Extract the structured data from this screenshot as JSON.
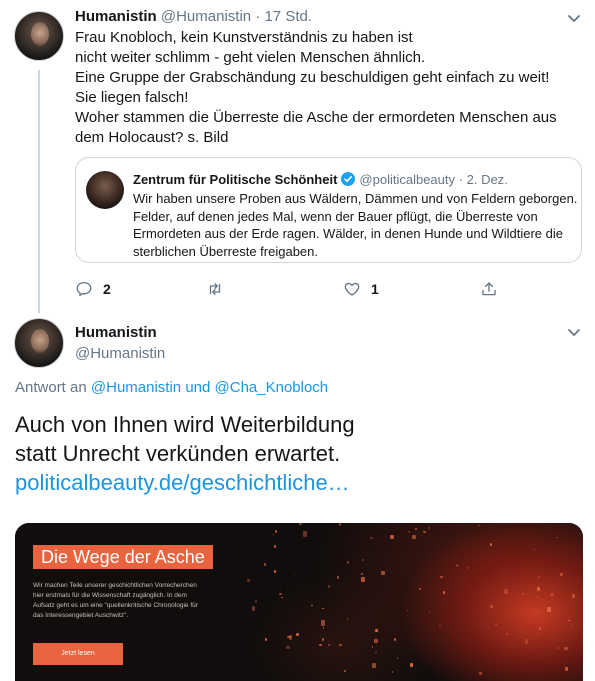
{
  "tweet1": {
    "name": "Humanistin",
    "handle": "@Humanistin",
    "separator": "·",
    "time": "17 Std.",
    "lines": [
      "Frau Knobloch, kein Kunstverständnis zu haben ist",
      "nicht weiter schlimm - geht vielen Menschen ähnlich.",
      "Eine Gruppe der Grabschändung zu beschuldigen geht einfach zu weit!",
      "Sie liegen falsch!",
      "Woher stammen die Überreste die Asche der ermordeten Menschen aus",
      "dem Holocaust? s. Bild"
    ],
    "quote": {
      "name": "Zentrum für Politische Schönheit",
      "handle": "@politicalbeauty",
      "separator": "·",
      "time": "2. Dez.",
      "lines": [
        "Wir haben unsere Proben aus Wäldern, Dämmen und von Feldern geborgen.",
        "Felder, auf denen jedes Mal, wenn der Bauer pflügt, die Überreste von",
        "Ermordeten aus der Erde ragen. Wälder, in denen Hunde und Wildtiere die",
        "sterblichen Überreste freigaben."
      ]
    },
    "actions": {
      "reply_count": "2",
      "retweet_count": "",
      "like_count": "1"
    }
  },
  "tweet2": {
    "name": "Humanistin",
    "handle": "@Humanistin",
    "reply_prefix": "Antwort an",
    "reply_users": "@Humanistin und @Cha_Knobloch",
    "text_lines": [
      "Auch von Ihnen wird Weiterbildung",
      "statt Unrecht verkünden erwartet."
    ],
    "link": "politicalbeauty.de/geschichtliche…",
    "card": {
      "title": "Die Wege der Asche",
      "desc_lines": [
        "Wir machen Teile unserer geschichtlichen Vorrecherchen",
        "hier erstmals für die Wissenschaft zugänglich. In dem",
        "Aufsatz geht es um eine \"quellenkritische Chronologie für",
        "das Interessengebiet Auschwitz\"."
      ],
      "button": "Jetzt lesen"
    }
  },
  "icons": {
    "reply": "reply-icon",
    "retweet": "retweet-icon",
    "like": "heart-icon",
    "share": "share-icon",
    "menu": "chevron-down-icon",
    "verified": "verified-badge-icon"
  },
  "colors": {
    "accent": "#1b95e0",
    "card_orange": "#e9633f",
    "muted": "#657786"
  }
}
